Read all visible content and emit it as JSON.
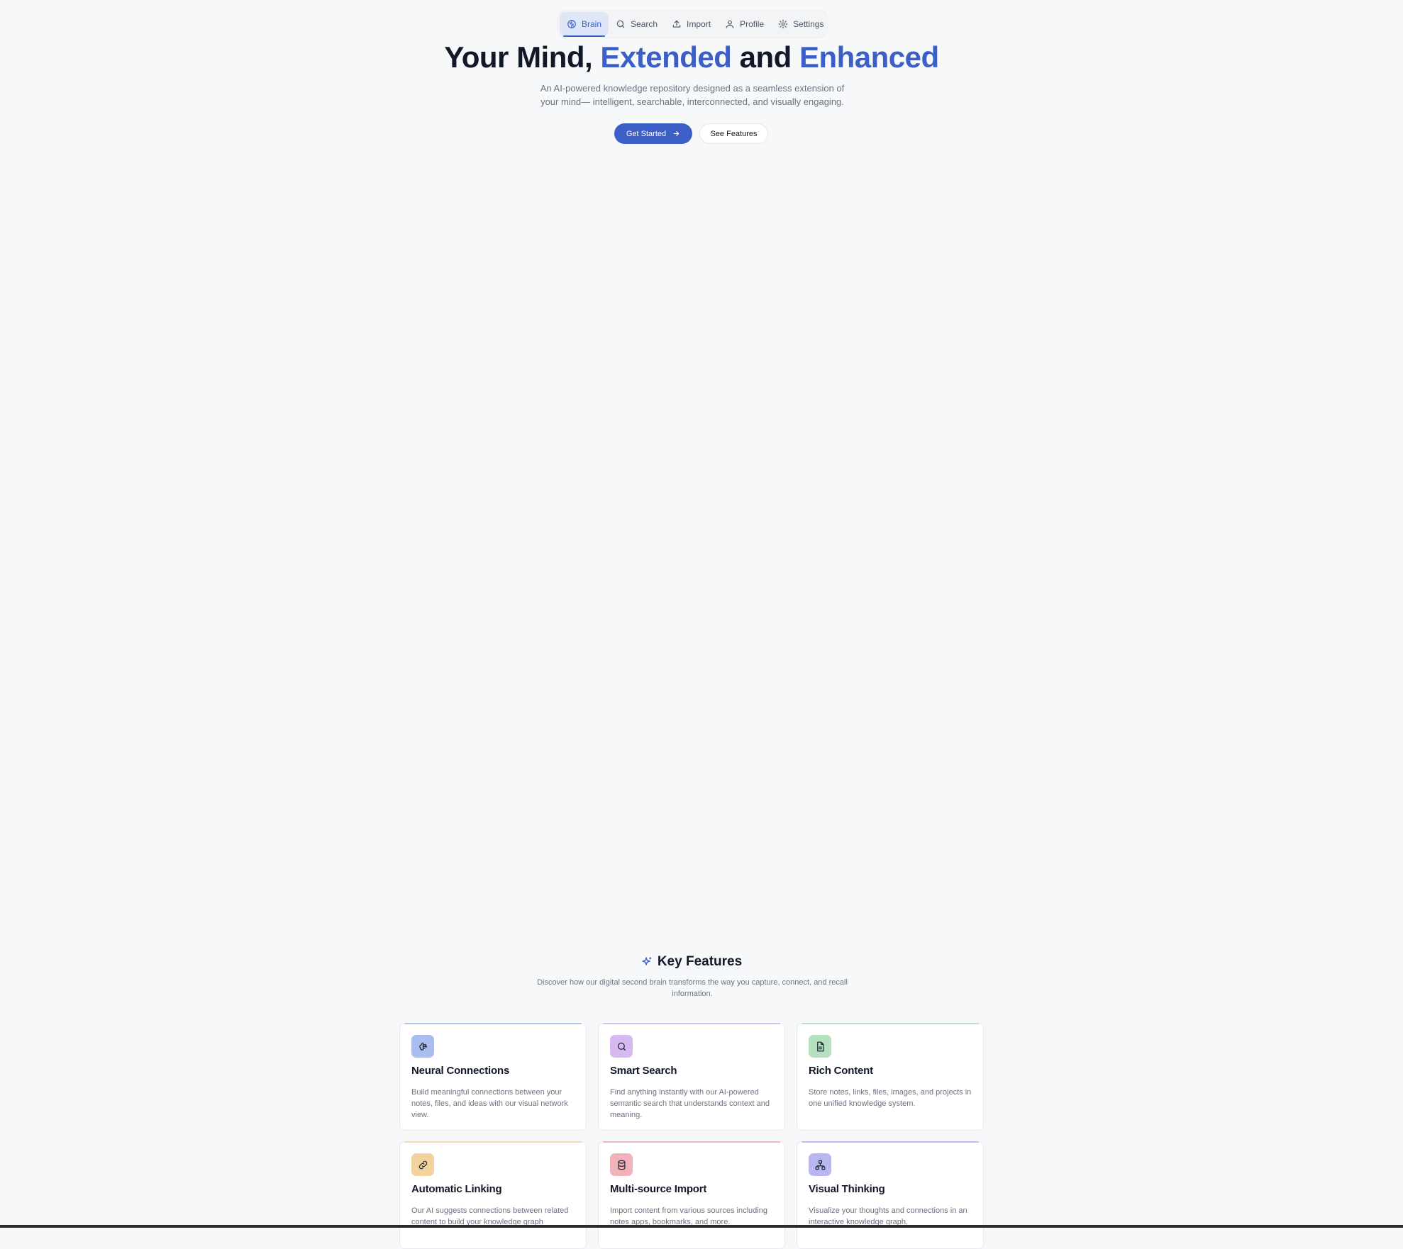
{
  "nav": {
    "items": [
      {
        "label": "Brain",
        "icon": "brain-icon"
      },
      {
        "label": "Search",
        "icon": "search-icon"
      },
      {
        "label": "Import",
        "icon": "upload-icon"
      },
      {
        "label": "Profile",
        "icon": "user-icon"
      },
      {
        "label": "Settings",
        "icon": "gear-icon"
      }
    ],
    "active": "Brain"
  },
  "hero": {
    "title_part1": "Your Mind, ",
    "title_accent1": "Extended",
    "title_part2": " and ",
    "title_accent2": "Enhanced",
    "subtitle": "An AI-powered knowledge repository designed as a seamless extension of your mind— intelligent, searchable, interconnected, and visually engaging.",
    "primary_cta": "Get Started",
    "secondary_cta": "See Features"
  },
  "features": {
    "title": "Key Features",
    "subtitle": "Discover how our digital second brain transforms the way you capture, connect, and recall information.",
    "cards": [
      {
        "title": "Neural Connections",
        "desc": "Build meaningful connections between your notes, files, and ideas with our visual network view.",
        "icon": "brain-circuit-icon",
        "color": "#a9bdf0",
        "bar": "#b3c3f2"
      },
      {
        "title": "Smart Search",
        "desc": "Find anything instantly with our AI-powered semantic search that understands context and meaning.",
        "icon": "search-icon",
        "color": "#d7b8f0",
        "bar": "#d8c0f2"
      },
      {
        "title": "Rich Content",
        "desc": "Store notes, links, files, images, and projects in one unified knowledge system.",
        "icon": "document-icon",
        "color": "#b4e0bd",
        "bar": "#b8e3c0"
      },
      {
        "title": "Automatic Linking",
        "desc": "Our AI suggests connections between related content to build your knowledge graph",
        "icon": "link-icon",
        "color": "#f2d29d",
        "bar": "#f0d9aa"
      },
      {
        "title": "Multi-source Import",
        "desc": "Import content from various sources including notes apps, bookmarks, and more.",
        "icon": "database-icon",
        "color": "#f2b2bb",
        "bar": "#f0b8c0"
      },
      {
        "title": "Visual Thinking",
        "desc": "Visualize your thoughts and connections in an interactive knowledge graph.",
        "icon": "network-icon",
        "color": "#b9b7f2",
        "bar": "#bfbdf2"
      }
    ]
  },
  "colors": {
    "accent": "#3b5fc6",
    "background": "#f7f8fa",
    "muted_text": "#6b7280"
  }
}
